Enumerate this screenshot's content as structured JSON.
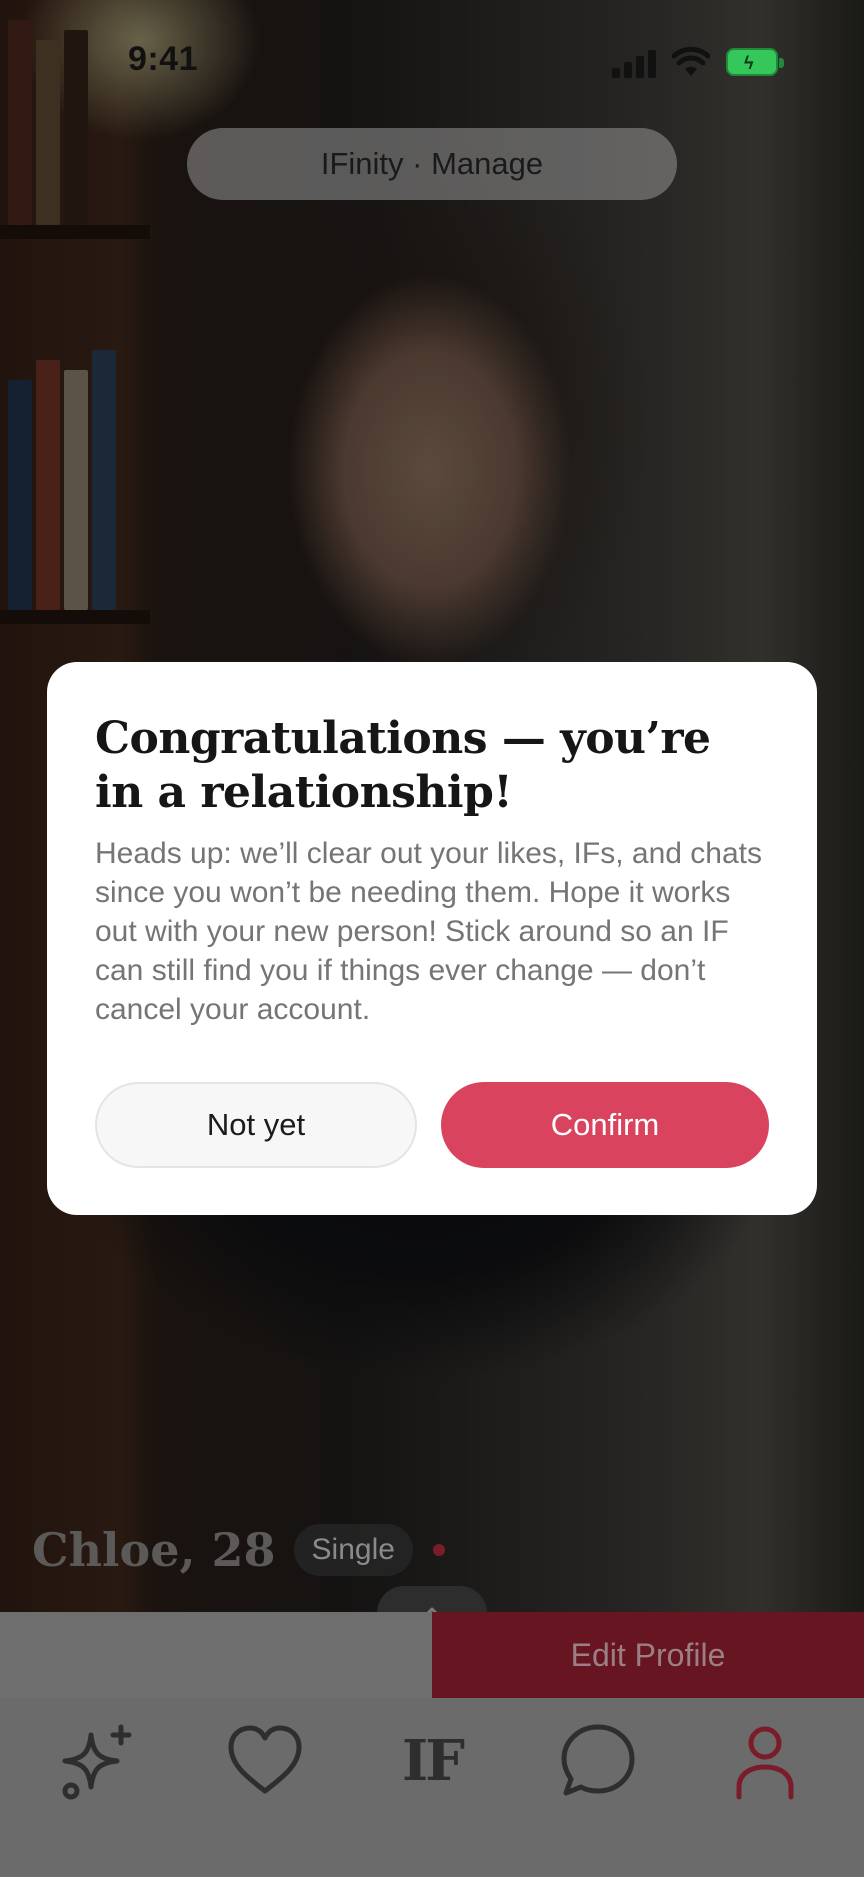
{
  "status_bar": {
    "time": "9:41"
  },
  "top_pill": {
    "label": "IFinity · Manage"
  },
  "profile": {
    "name": "Chloe, 28",
    "status_badge": "Single"
  },
  "actions": {
    "edit_profile": "Edit Profile"
  },
  "nav": {
    "items": [
      {
        "icon": "sparkle-icon"
      },
      {
        "icon": "heart-icon"
      },
      {
        "icon": "if-logo",
        "label": "IF"
      },
      {
        "icon": "chat-bubble-icon"
      },
      {
        "icon": "profile-icon",
        "active": true
      }
    ],
    "active_color": "#d9435e"
  },
  "modal": {
    "title": "Congratulations — you’re in a relationship!",
    "body": "Heads up: we’ll clear out your likes, IFs, and chats since you won’t be needing them. Hope it works out with your new person! Stick around so an IF can still find you if things ever change — don’t cancel your account.",
    "secondary_button": "Not yet",
    "primary_button": "Confirm",
    "accent_color": "#d9435e"
  }
}
